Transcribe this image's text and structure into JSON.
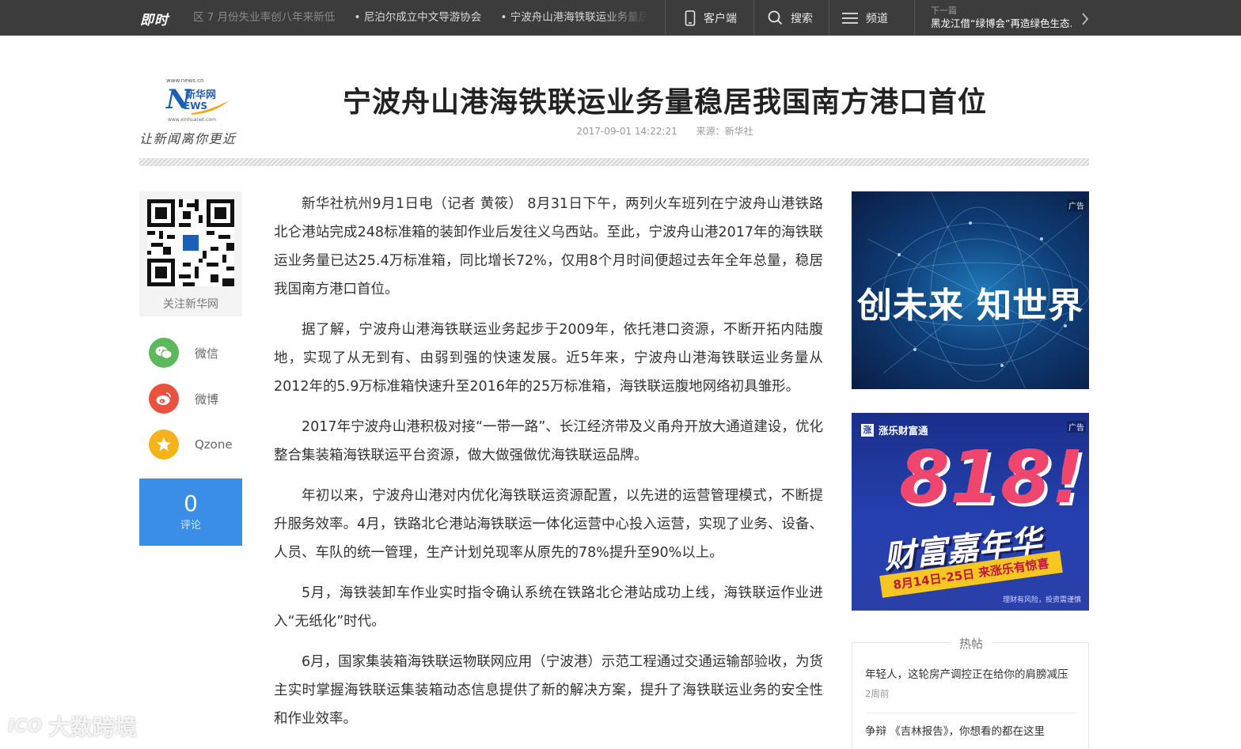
{
  "topbar": {
    "brand": "即时",
    "ticker": [
      "区 7 月份失业率创八年来新低",
      "• 尼泊尔成立中文导游协会",
      "• 宁波舟山港海铁联运业务量居"
    ],
    "client_label": "客户端",
    "search_label": "搜索",
    "channel_label": "频道",
    "next_label": "下一篇",
    "next_title": "黑龙江借“绿博会”再造绿色生态..."
  },
  "logo": {
    "url_top": "www.news.cn",
    "mark_letter": "N",
    "mark_cn": "新华网",
    "mark_ews": "EWS",
    "url_bottom": "www.xinhuanet.com",
    "slogan": "让新闻离你更近"
  },
  "article": {
    "title": "宁波舟山港海铁联运业务量稳居我国南方港口首位",
    "datetime": "2017-09-01 14:22:21",
    "source": "来源：新华社",
    "paragraphs": [
      "新华社杭州9月1日电（记者 黄筱） 8月31日下午，两列火车班列在宁波舟山港铁路北仑港站完成248标准箱的装卸作业后发往义乌西站。至此，宁波舟山港2017年的海铁联运业务量已达25.4万标准箱，同比增长72%，仅用8个月时间便超过去年全年总量，稳居我国南方港口首位。",
      "据了解，宁波舟山港海铁联运业务起步于2009年，依托港口资源，不断开拓内陆腹地，实现了从无到有、由弱到强的快速发展。近5年来，宁波舟山港海铁联运业务量从2012年的5.9万标准箱快速升至2016年的25万标准箱，海铁联运腹地网络初具雏形。",
      "2017年宁波舟山港积极对接“一带一路”、长江经济带及义甬舟开放大通道建设，优化整合集装箱海铁联运平台资源，做大做强做优海铁联运品牌。",
      "年初以来，宁波舟山港对内优化海铁联运资源配置，以先进的运营管理模式，不断提升服务效率。4月，铁路北仑港站海铁联运一体化运营中心投入运营，实现了业务、设备、人员、车队的统一管理，生产计划兑现率从原先的78%提升至90%以上。",
      "5月，海铁装卸车作业实时指令确认系统在铁路北仑港站成功上线，海铁联运作业进入“无纸化”时代。",
      "6月，国家集装箱海铁联运物联网应用（宁波港）示范工程通过交通运输部验收，为货主实时掌握海铁联运集装箱动态信息提供了新的解决方案，提升了海铁联运业务的安全性和作业效率。"
    ]
  },
  "sidebar": {
    "qr_caption": "关注新华网",
    "share": [
      {
        "label": "微信",
        "color": "#5cb85c",
        "icon": "wechat-icon"
      },
      {
        "label": "微博",
        "color": "#e8523f",
        "icon": "weibo-icon"
      },
      {
        "label": "Qzone",
        "color": "#f5b31b",
        "icon": "qzone-star-icon"
      }
    ],
    "comment_count": "0",
    "comment_label": "评论"
  },
  "ads": {
    "tag": "广告",
    "ad1_text": "创未来 知世界",
    "ad2_brand_mark": "涨",
    "ad2_brand": "涨乐财富通",
    "ad2_number": "818!",
    "ad2_sub": "财富嘉年华",
    "ad2_band": "8月14日-25日 来涨乐有惊喜",
    "ad2_note": "理财有风险，投资需谨慎"
  },
  "hot": {
    "title": "热帖",
    "items": [
      {
        "title": "年轻人，这轮房产调控正在给你的肩膀减压",
        "time": "2周前"
      },
      {
        "title": "争辩 《吉林报告》，你想看的都在这里",
        "time": ""
      }
    ]
  },
  "watermark": {
    "logo": "ICO",
    "text": "大数跨境"
  },
  "colors": {
    "topbar_bg": "#3c3c3c",
    "comment_bg": "#3a8ee6",
    "brand_blue": "#1c5fb7"
  }
}
